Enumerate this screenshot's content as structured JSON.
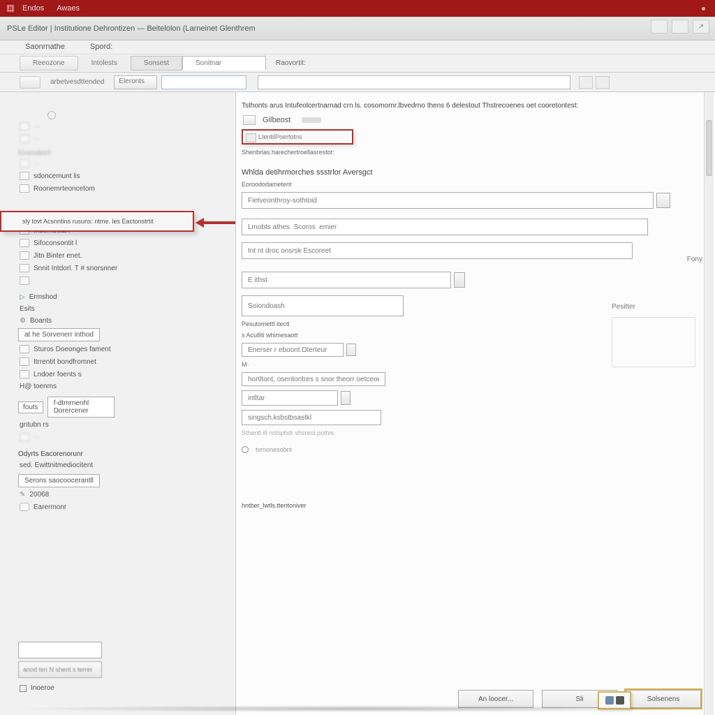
{
  "titlebar": {
    "menu1": "Endos",
    "menu2": "Awaes"
  },
  "winrow": {
    "title": "PSLe Editor | Institutione   Dehrontizen — Beitelolon (Larneinet Glenthrem"
  },
  "ribtabs": {
    "t1": "Saonrnathe",
    "t2": "Spord:"
  },
  "sectabs": {
    "t1": "Reeozone",
    "t2": "Intolests",
    "t3": "Sonsest",
    "t4": "Sonitnar",
    "lbl": "Raovortit:"
  },
  "filterrow": {
    "field": "arbetvesdttended",
    "drop": "Eleronts",
    "search_ph": ""
  },
  "sidebar": {
    "groupA": "Eivendetril",
    "a1": "sdoncemunt lis",
    "a2": "Roonemrteoncetom",
    "hl": "sly tovt Acsnntins  rusuns: ntme. les Eactonstrtit",
    "b1": "Indemboat l",
    "b2": "Sifoconsontit l",
    "b3": "Jitn Binter enet.",
    "b4": "Snnit Intdorl. T # snorsnner",
    "c1": "Ermshod",
    "c2": "Esits",
    "c3": "Boants",
    "catbox": "at he Sorvenerr inthod",
    "d1": "Sturos Doeonges fament",
    "d2": "Itrrentit bondfromnet",
    "d3": "Lndoer foents s",
    "d4": "H@ toenms",
    "jlbl": "fouts",
    "jval": "f-dtmrnenhl Dorercener",
    "e1": "gntubn rs",
    "f1": "Odyrts Eacorenorunr",
    "f2": "sed. Ewittnitmediocitent",
    "g1": "Serons saocoocerantll",
    "g2": "20068",
    "g3": "Earermonr",
    "chk": "Inoeroe"
  },
  "content": {
    "desc": "Tsthonts arus Intufeolcertnarnad crn ls. cosomornr.lbvedrno thens 6 delestout Thstrecoenes oet cooretontest:",
    "node1": "Gilbeost",
    "node_hl": "LtentilPoertotns",
    "hint": "Shenbrias.harechertroellasrestot:",
    "sec1": "Whlda detihrmorches  ssstrlor Aversgct",
    "lbl1": "Eoroododametent",
    "inp1": "Fietveonthroy-sothtoid",
    "inp2": "Lmobts athes  Scoros  emier",
    "inp3": "Int nt droc onsrsk Escoreet",
    "inp4": "E ithst",
    "pos": "Pesitter",
    "inp5": "Soiondoash",
    "lbl2": "Pesutomettl itectl",
    "lbl3": "s Aculliti whimesaott",
    "inp6": "Enerser r eboont.Dterteur",
    "mi": "M·",
    "inp7": "hortltont, osentoritres s snor theorr oetceoe",
    "inp8": "intltar",
    "inp9": "singsch.ksbstbsastkl",
    "note": "Sthentl ill notsphdr shsreol pothis",
    "radio1": "tvrnonesobnt",
    "foot_label": "hntber_lwtls.ttentoniver"
  },
  "footer": {
    "b1": "An loocer...",
    "b2": "Sli",
    "b3": "Solsenens"
  }
}
